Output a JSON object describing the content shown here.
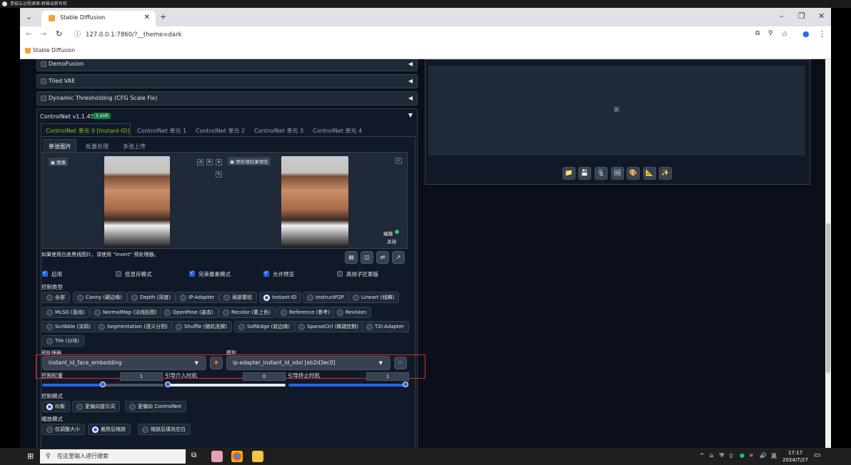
{
  "remote_title": "青椒云远程桌面:野兽出新有机",
  "browser": {
    "tab_title": "Stable Diffusion",
    "url": "127.0.0.1:7860/?__theme=dark",
    "bookmark": "Stable Diffusion"
  },
  "accordions": [
    "DemoFusion",
    "Tiled VAE",
    "Dynamic Thresholding (CFG Scale Fix)"
  ],
  "controlnet": {
    "title": "ControlNet v1.1.455",
    "badge": "1 unit",
    "unit_tabs": [
      "ControlNet 单元 0 [Instant-ID]",
      "ControlNet 单元 1",
      "ControlNet 单元 2",
      "ControlNet 单元 3",
      "ControlNet 单元 4"
    ],
    "image_tabs": [
      "单张图片",
      "批量处理",
      "多张上传"
    ],
    "image_label": "图像",
    "preview_label": "预处理结果预览",
    "edit_label": "编辑",
    "close_label": "关闭",
    "hint": "如果使用白底黑线图片，请使用 \"invert\" 预处理器。",
    "checkboxes": [
      {
        "label": "启用",
        "checked": true
      },
      {
        "label": "低显存模式",
        "checked": false
      },
      {
        "label": "完美像素模式",
        "checked": true
      },
      {
        "label": "允许预览",
        "checked": true
      },
      {
        "label": "高效子区索版",
        "checked": false
      }
    ],
    "control_type_label": "控制类型",
    "control_types_row1": [
      "全部",
      "Canny (硬边缘)",
      "Depth (深度)",
      "IP-Adapter",
      "局部重绘",
      "Instant-ID",
      "InstructP2P",
      "Lineart (线稿)"
    ],
    "control_types_row2": [
      "MLSD (直线)",
      "NormalMap (法线贴图)",
      "OpenPose (姿态)",
      "Recolor (重上色)",
      "Reference (参考)",
      "Revision"
    ],
    "control_types_row3": [
      "Scribble (涂鸦)",
      "Segmentation (语义分割)",
      "Shuffle (随机洗牌)",
      "SoftEdge (软边缘)",
      "SparseCtrl (稀疏控制)",
      "T2I-Adapter"
    ],
    "control_types_row4": [
      "Tile (分块)"
    ],
    "selected_type": "Instant-ID",
    "preprocessor_label": "预处理器",
    "preprocessor_value": "instant_id_face_embedding",
    "model_label": "模型",
    "model_value": "ip-adapter_instant_id_sdxl [eb2d3ec0]",
    "weight_label": "控制权重",
    "weight_value": "1",
    "start_label": "引导介入时机",
    "start_value": "0",
    "end_label": "引导终止时机",
    "end_value": "1",
    "control_mode_label": "控制模式",
    "control_modes": [
      "均衡",
      "更偏向提示词",
      "更偏向 ControlNet"
    ],
    "resize_label": "缩放模式",
    "resize_modes": [
      "仅调整大小",
      "裁剪后缩放",
      "缩放后填充空白"
    ]
  },
  "taskbar": {
    "search_placeholder": "在这里输入进行搜索",
    "time": "17:17",
    "date": "2024/7/27",
    "ime": "英"
  }
}
